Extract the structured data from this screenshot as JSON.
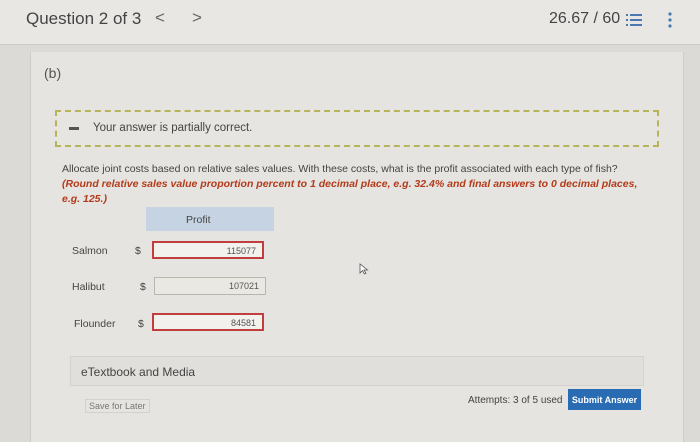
{
  "header": {
    "question_title": "Question 2 of 3",
    "prev_arrow": "<",
    "next_arrow": ">",
    "score": "26.67 / 60"
  },
  "part": {
    "label": "(b)"
  },
  "feedback": {
    "message": "Your answer is partially correct."
  },
  "instructions": {
    "text": "Allocate joint costs based on relative sales values. With these costs, what is the profit associated with each type of fish?",
    "emphasis": "(Round relative sales value proportion percent to 1 decimal place, e.g. 32.4% and final answers to 0 decimal places, e.g. 125.)"
  },
  "table": {
    "column_header": "Profit",
    "rows": [
      {
        "label": "Salmon",
        "currency": "$",
        "value": "115077",
        "status": "incorrect"
      },
      {
        "label": "Halibut",
        "currency": "$",
        "value": "107021",
        "status": "correct"
      },
      {
        "label": "Flounder",
        "currency": "$",
        "value": "84581",
        "status": "incorrect"
      }
    ]
  },
  "etextbook": {
    "label": "eTextbook and Media"
  },
  "footer": {
    "save_label": "Save for Later",
    "attempts": "Attempts: 3 of 5 used",
    "submit_label": "Submit Answer"
  },
  "colors": {
    "incorrect_border": "#c23d3d",
    "submit_bg": "#2a6cb3",
    "emphasis": "#b33a1a",
    "table_header_bg": "#c5d3e2"
  },
  "icons": [
    "list-icon",
    "more-vertical-icon",
    "cursor-icon"
  ]
}
